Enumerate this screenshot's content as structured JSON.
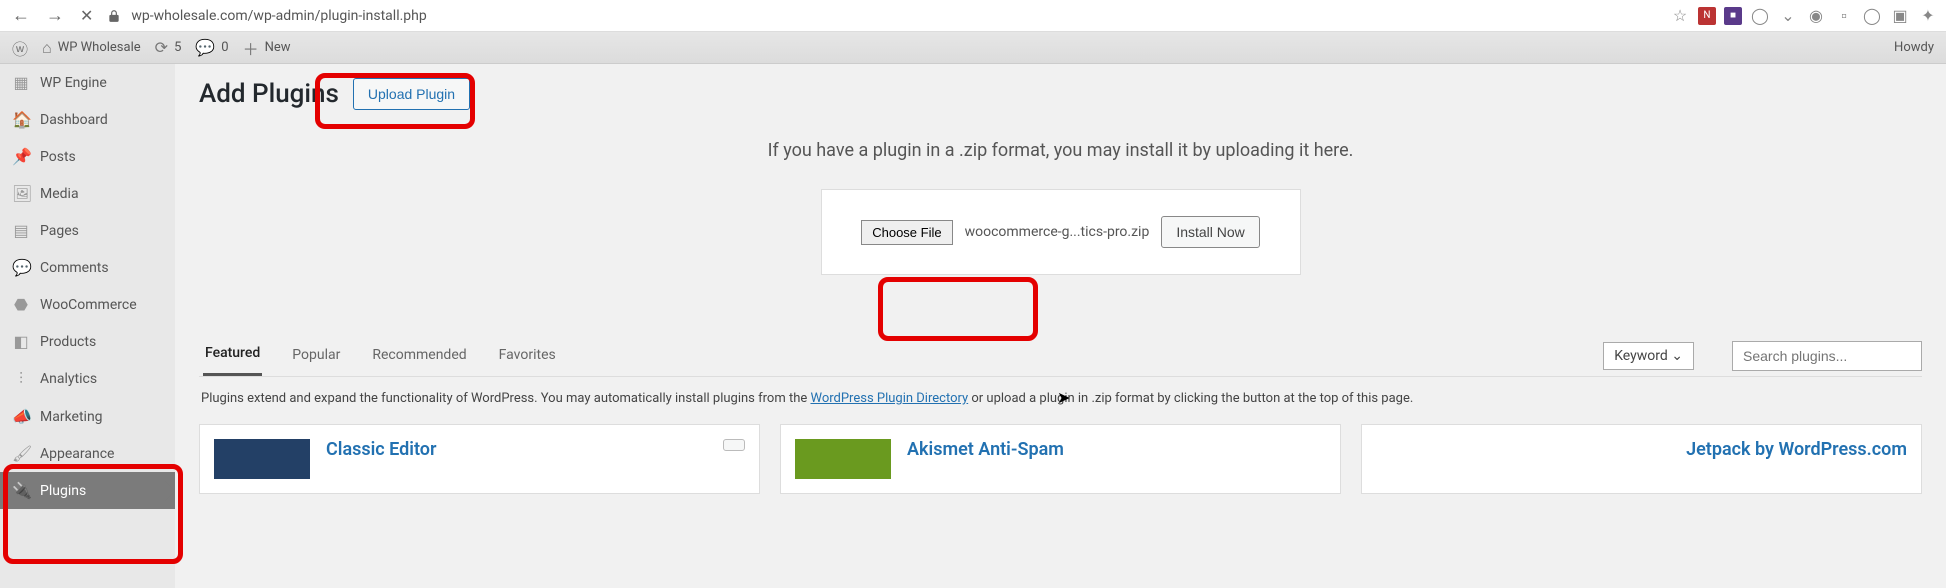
{
  "browser": {
    "url": "wp-wholesale.com/wp-admin/plugin-install.php"
  },
  "adminbar": {
    "site_name": "WP Wholesale",
    "updates_count": "5",
    "comments_count": "0",
    "new_label": "New",
    "howdy": "Howdy"
  },
  "sidebar": {
    "items": [
      {
        "label": "WP Engine"
      },
      {
        "label": "Dashboard"
      },
      {
        "label": "Posts"
      },
      {
        "label": "Media"
      },
      {
        "label": "Pages"
      },
      {
        "label": "Comments"
      },
      {
        "label": "WooCommerce"
      },
      {
        "label": "Products"
      },
      {
        "label": "Analytics"
      },
      {
        "label": "Marketing"
      },
      {
        "label": "Appearance"
      },
      {
        "label": "Plugins"
      }
    ]
  },
  "page": {
    "title": "Add Plugins",
    "upload_btn": "Upload Plugin",
    "upload_help": "If you have a plugin in a .zip format, you may install it by uploading it here.",
    "choose_file": "Choose File",
    "file_name": "woocommerce-g...tics-pro.zip",
    "install_now": "Install Now"
  },
  "filters": {
    "tabs": [
      "Featured",
      "Popular",
      "Recommended",
      "Favorites"
    ],
    "keyword_label": "Keyword",
    "search_placeholder": "Search plugins..."
  },
  "intro": {
    "before": "Plugins extend and expand the functionality of WordPress. You may automatically install plugins from the ",
    "link": "WordPress Plugin Directory",
    "after": " or upload a plugin in .zip format by clicking the button at the top of this page."
  },
  "cards": {
    "classic_editor": "Classic Editor",
    "akismet": "Akismet Anti-Spam",
    "jetpack": "Jetpack by WordPress.com",
    "active_btn": ""
  }
}
